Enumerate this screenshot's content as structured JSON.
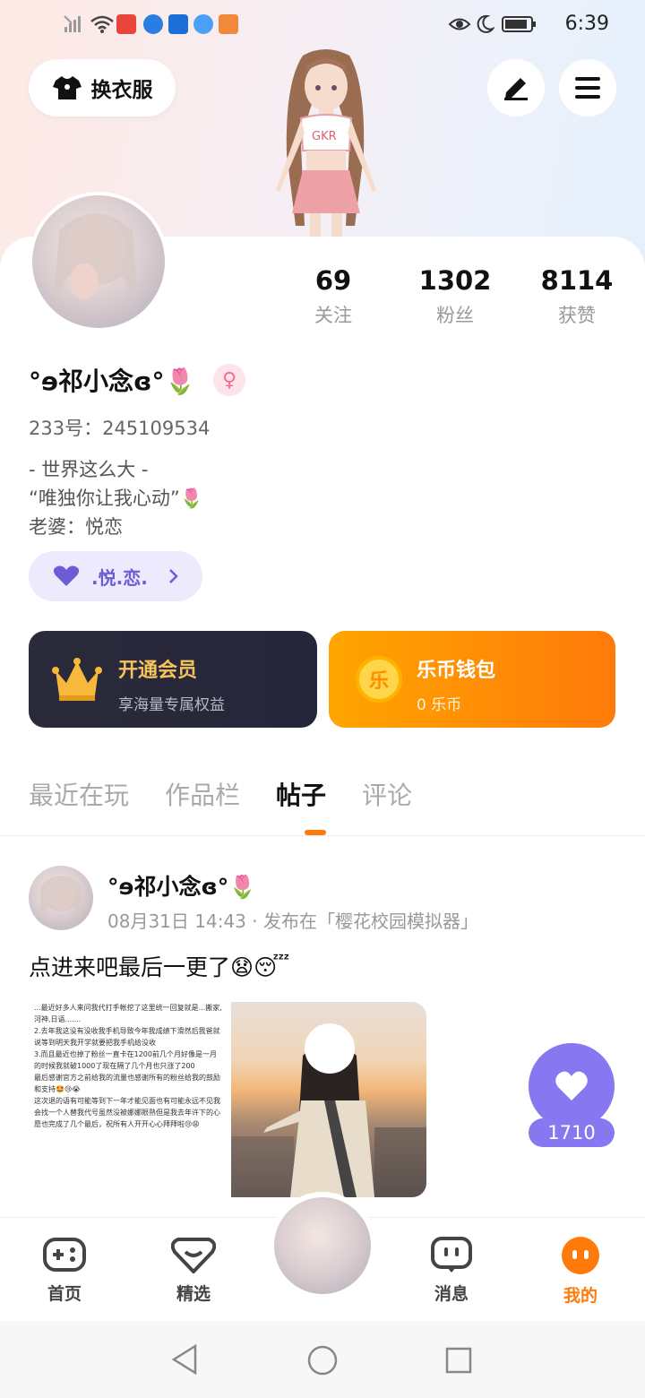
{
  "status_bar": {
    "time": "6:39"
  },
  "header": {
    "dress_label": "换衣服"
  },
  "profile": {
    "stats": [
      {
        "num": "69",
        "label": "关注"
      },
      {
        "num": "1302",
        "label": "粉丝"
      },
      {
        "num": "8114",
        "label": "获赞"
      }
    ],
    "name": "°ɘ祁小念ɞ°🌷",
    "gender_symbol": "♀",
    "uid": "233号：245109534",
    "bio": [
      "- 世界这么大 -",
      "“唯独你让我心动”🌷",
      "老婆：悦恋"
    ],
    "tag": ".悦.恋."
  },
  "vip_card": {
    "title": "开通会员",
    "sub": "享海量专属权益"
  },
  "wallet_card": {
    "title": "乐币钱包",
    "sub": "0 乐币",
    "coin_glyph": "乐"
  },
  "tabs": [
    {
      "label": "最近在玩"
    },
    {
      "label": "作品栏"
    },
    {
      "label": "帖子"
    },
    {
      "label": "评论"
    }
  ],
  "post": {
    "author": "°ɘ祁小念ɞ°🌷",
    "meta": "08月31日 14:43 · 发布在「樱花校园模拟器」",
    "text": "点进来吧最后一更了😧😴",
    "image_text": "...最近好多人来问我代打手帐挖了这里统一回复就是...搬家,河神,日语.......\n2.去年我这没有没收我手机导致今年我成绩下滑然后我爸就说等到明天我开学就要把我手机给没收\n3.而且最近也掉了粉丝一直卡在1200前几个月好像是一月的时候我就破1000了现在隔了几个月也只涨了200\n最后感谢官方之前给我的流量也感谢所有的粉丝给我的鼓励和支持🤩😢😭\n这次退的语有可能等到下一年才能见面也有可能永远不见我会找一个人替我代号虽然没被娜娜眼熟但是我去年许下的心愿也完成了几个最后，祝所有人开开心心拜拜啦😢😩",
    "likes": "1710"
  },
  "bottom_nav": [
    {
      "label": "首页"
    },
    {
      "label": "精选"
    },
    {
      "label": ""
    },
    {
      "label": "消息"
    },
    {
      "label": "我的"
    }
  ],
  "colors": {
    "accent_orange": "#ff7a0a",
    "purple": "#8777f1",
    "tag_purple": "#6c5cd6"
  }
}
